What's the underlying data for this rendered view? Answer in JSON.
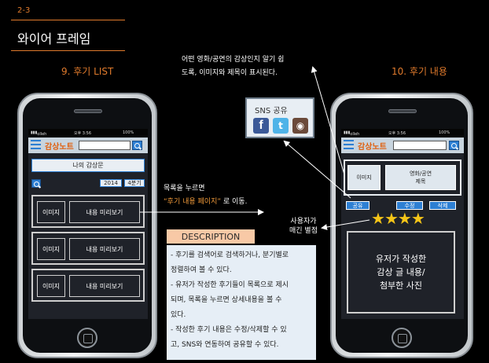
{
  "header": {
    "section_number": "2-3",
    "section_title": "와이어 프레임"
  },
  "screens": {
    "left_label": "9. 후기 LIST",
    "right_label": "10. 후기 내용"
  },
  "phone_common": {
    "carrier": "olleh",
    "time": "오후 3:56",
    "battery": "100%",
    "logo": "감상노트"
  },
  "review_list": {
    "my_reviews_button": "나의 감상문",
    "filter_year": "2014",
    "filter_quarter": "4분기",
    "items": [
      {
        "image": "이미지",
        "preview": "내용 미리보기"
      },
      {
        "image": "이미지",
        "preview": "내용 미리보기"
      },
      {
        "image": "이미지",
        "preview": "내용 미리보기"
      }
    ]
  },
  "review_detail": {
    "image": "이미지",
    "title_box": "영화/공연\n제목",
    "share_button": "공유",
    "edit_button": "수정",
    "delete_button": "삭제",
    "rating": 4,
    "rating_max": 4,
    "content_box": "유저가 작성한\n감상 글 내용/\n첨부한 사진"
  },
  "annotations": {
    "top": [
      "어떤 영화/공연의 감상인지 알기 쉽",
      "도록, 이미지와 제목이 표시된다."
    ],
    "list_line1": "목록을 누르면",
    "list_link": "“후기 내용 페이지”",
    "list_suffix": " 로 이동.",
    "rating": [
      "사용자가",
      "매긴 별점"
    ]
  },
  "sns": {
    "title": "SNS 공유",
    "icons": [
      "facebook-icon",
      "twitter-icon",
      "instagram-icon"
    ]
  },
  "description": {
    "label": "DESCRIPTION",
    "lines": [
      "- 후기를 검색어로 검색하거나, 분기별로",
      "정렬하여 볼 수 있다.",
      "- 유저가 작성한 후기들이 목록으로 제시",
      "되며, 목록을 누르면 상세내용을 볼 수",
      "있다.",
      "- 작성한 후기 내용은 수정/삭제할 수 있",
      "고, SNS와 연동하여 공유할 수 있다."
    ]
  },
  "colors": {
    "accent_orange": "#e07a2c",
    "link_orange": "#f29b3a",
    "button_blue": "#2d7fd3",
    "star_gold": "#f5c518",
    "description_label_bg": "#f8c9a6",
    "description_body_bg": "#e6eef6"
  }
}
